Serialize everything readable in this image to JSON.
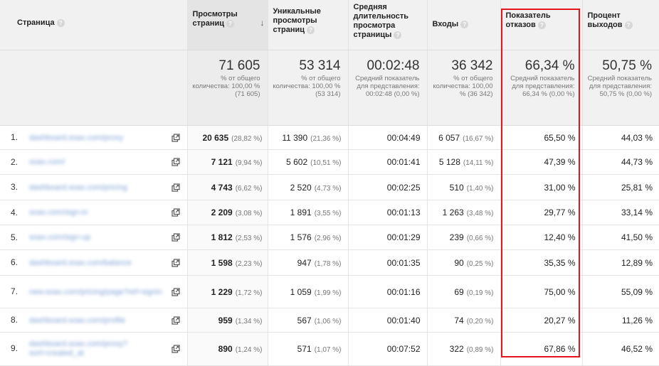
{
  "columns": {
    "page": "Страница",
    "views": "Просмотры страниц",
    "unique_views": "Уникальные просмотры страниц",
    "avg_time": "Средняя длительность просмотра страницы",
    "entrances": "Входы",
    "bounce_rate": "Показатель отказов",
    "exit_rate": "Процент выходов"
  },
  "help_glyph": "?",
  "sort_glyph": "↓",
  "summary": {
    "views": {
      "value": "71 605",
      "note": "% от общего количества: 100,00 % (71 605)"
    },
    "unique_views": {
      "value": "53 314",
      "note": "% от общего количества: 100,00 % (53 314)"
    },
    "avg_time": {
      "value": "00:02:48",
      "note": "Средний показатель для представления: 00:02:48 (0,00 %)"
    },
    "entrances": {
      "value": "36 342",
      "note": "% от общего количества: 100,00 % (36 342)"
    },
    "bounce_rate": {
      "value": "66,34 %",
      "note": "Средний показатель для представления: 66,34 % (0,00 %)"
    },
    "exit_rate": {
      "value": "50,75 %",
      "note": "Средний показатель для представления: 50,75 % (0,00 %)"
    }
  },
  "rows": [
    {
      "num": "1.",
      "url": "dashboard.soax.com/proxy",
      "views": "20 635",
      "views_pct": "(28,82 %)",
      "unique": "11 390",
      "unique_pct": "(21,36 %)",
      "avg_time": "00:04:49",
      "entrances": "6 057",
      "entrances_pct": "(16,67 %)",
      "bounce": "65,50 %",
      "exit": "44,03 %"
    },
    {
      "num": "2.",
      "url": "soax.com/",
      "views": "7 121",
      "views_pct": "(9,94 %)",
      "unique": "5 602",
      "unique_pct": "(10,51 %)",
      "avg_time": "00:01:41",
      "entrances": "5 128",
      "entrances_pct": "(14,11 %)",
      "bounce": "47,39 %",
      "exit": "44,73 %"
    },
    {
      "num": "3.",
      "url": "dashboard.soax.com/pricing",
      "views": "4 743",
      "views_pct": "(6,62 %)",
      "unique": "2 520",
      "unique_pct": "(4,73 %)",
      "avg_time": "00:02:25",
      "entrances": "510",
      "entrances_pct": "(1,40 %)",
      "bounce": "31,00 %",
      "exit": "25,81 %"
    },
    {
      "num": "4.",
      "url": "soax.com/sign-in",
      "views": "2 209",
      "views_pct": "(3,08 %)",
      "unique": "1 891",
      "unique_pct": "(3,55 %)",
      "avg_time": "00:01:13",
      "entrances": "1 263",
      "entrances_pct": "(3,48 %)",
      "bounce": "29,77 %",
      "exit": "33,14 %"
    },
    {
      "num": "5.",
      "url": "soax.com/sign-up",
      "views": "1 812",
      "views_pct": "(2,53 %)",
      "unique": "1 576",
      "unique_pct": "(2,96 %)",
      "avg_time": "00:01:29",
      "entrances": "239",
      "entrances_pct": "(0,66 %)",
      "bounce": "12,40 %",
      "exit": "41,50 %"
    },
    {
      "num": "6.",
      "url": "dashboard.soax.com/balance",
      "views": "1 598",
      "views_pct": "(2,23 %)",
      "unique": "947",
      "unique_pct": "(1,78 %)",
      "avg_time": "00:01:35",
      "entrances": "90",
      "entrances_pct": "(0,25 %)",
      "bounce": "35,35 %",
      "exit": "12,89 %"
    },
    {
      "num": "7.",
      "url": "new.soax.com/pricing/page?ref=signin",
      "views": "1 229",
      "views_pct": "(1,72 %)",
      "unique": "1 059",
      "unique_pct": "(1,99 %)",
      "avg_time": "00:01:16",
      "entrances": "69",
      "entrances_pct": "(0,19 %)",
      "bounce": "75,00 %",
      "exit": "55,09 %"
    },
    {
      "num": "8.",
      "url": "dashboard.soax.com/profile",
      "views": "959",
      "views_pct": "(1,34 %)",
      "unique": "567",
      "unique_pct": "(1,06 %)",
      "avg_time": "00:01:40",
      "entrances": "74",
      "entrances_pct": "(0,20 %)",
      "bounce": "20,27 %",
      "exit": "11,26 %"
    },
    {
      "num": "9.",
      "url": "dashboard.soax.com/proxy?sort=created_at",
      "views": "890",
      "views_pct": "(1,24 %)",
      "unique": "571",
      "unique_pct": "(1,07 %)",
      "avg_time": "00:07:52",
      "entrances": "322",
      "entrances_pct": "(0,89 %)",
      "bounce": "67,86 %",
      "exit": "46,52 %"
    }
  ],
  "colors": {
    "highlight": "#e8141b",
    "link": "#7da1d8",
    "header_bg": "#f1f1f1"
  }
}
